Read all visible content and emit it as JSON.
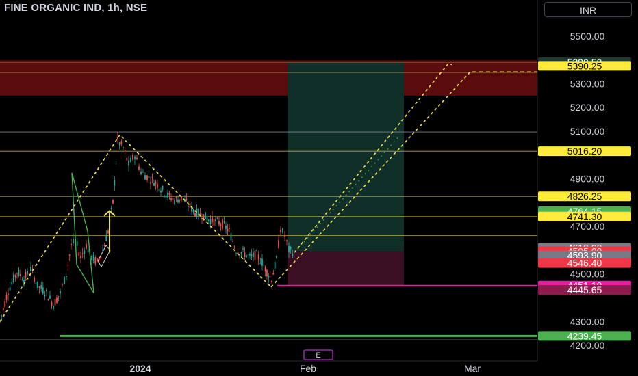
{
  "header": {
    "title": "FINE ORGANIC IND, 1h, NSE",
    "currency": "INR"
  },
  "chart_data": {
    "type": "candlestick",
    "title": "FINE ORGANIC IND, 1h, NSE",
    "ylim": [
      4160,
      5560
    ],
    "x_ticks": [
      "2024",
      "Feb",
      "Mar"
    ],
    "y_ticks": [
      "5500.00",
      "5300.00",
      "5200.00",
      "5100.00",
      "4900.00",
      "4700.00",
      "4500.00",
      "4300.00",
      "4200.00"
    ],
    "price_tags": [
      {
        "label": "5390.50",
        "value": 5390.5,
        "bg": "#1e3a30",
        "fg": "#ffffff"
      },
      {
        "label": "5390.25",
        "value": 5375,
        "bg": "#ffeb3b",
        "fg": "#000000"
      },
      {
        "label": "5016.20",
        "value": 5016.2,
        "bg": "#ffeb3b",
        "fg": "#000000"
      },
      {
        "label": "4826.25",
        "value": 4826.25,
        "bg": "#ffeb3b",
        "fg": "#000000"
      },
      {
        "label": "4764.15",
        "value": 4764.15,
        "bg": "#4caf50",
        "fg": "#ffffff"
      },
      {
        "label": "4741.30",
        "value": 4741.3,
        "bg": "#ffeb3b",
        "fg": "#000000"
      },
      {
        "label": "4610.00",
        "value": 4610,
        "bg": "#787b86",
        "fg": "#ffffff"
      },
      {
        "label": "4595.00",
        "value": 4595,
        "bg": "#f23645",
        "fg": "#ffffff"
      },
      {
        "label": "4593.90",
        "value": 4578,
        "bg": "#787b86",
        "fg": "#ffffff"
      },
      {
        "label": "4546.40",
        "value": 4546.4,
        "bg": "#f23645",
        "fg": "#ffffff"
      },
      {
        "label": "4451.10",
        "value": 4451.1,
        "bg": "#e91e9f",
        "fg": "#ffffff"
      },
      {
        "label": "4445.65",
        "value": 4433,
        "bg": "#8c1c4e",
        "fg": "#ffffff"
      },
      {
        "label": "4239.45",
        "value": 4239.45,
        "bg": "#4caf50",
        "fg": "#ffffff"
      }
    ],
    "horizontal_levels": [
      {
        "value": 5390.5,
        "color": "#c8a86a"
      },
      {
        "value": 5347,
        "color": "#c8a86a"
      },
      {
        "value": 5097,
        "color": "#9aa0aa"
      },
      {
        "value": 5016.2,
        "color": "#e6c84a"
      },
      {
        "value": 4826.25,
        "color": "#e6c84a"
      },
      {
        "value": 4741.3,
        "color": "#e6c84a"
      },
      {
        "value": 4662,
        "color": "#e6c84a"
      },
      {
        "value": 4223,
        "color": "#9aa0aa"
      }
    ],
    "resistance_zone": [
      5250,
      5398
    ],
    "support_line": 4239.45,
    "entry_line": 4451.1,
    "position": {
      "profit_top": 5390.5,
      "entry": 4595,
      "stop": 4451.1
    },
    "price_path": [
      [
        0,
        4300
      ],
      [
        12,
        4430
      ],
      [
        25,
        4510
      ],
      [
        35,
        4480
      ],
      [
        45,
        4520
      ],
      [
        55,
        4450
      ],
      [
        68,
        4420
      ],
      [
        78,
        4370
      ],
      [
        88,
        4420
      ],
      [
        97,
        4500
      ],
      [
        104,
        4620
      ],
      [
        110,
        4640
      ],
      [
        118,
        4570
      ],
      [
        126,
        4620
      ],
      [
        134,
        4570
      ],
      [
        142,
        4550
      ],
      [
        150,
        4600
      ],
      [
        158,
        4680
      ],
      [
        165,
        4800
      ],
      [
        172,
        5060
      ],
      [
        180,
        5030
      ],
      [
        188,
        4960
      ],
      [
        197,
        5000
      ],
      [
        206,
        4930
      ],
      [
        215,
        4910
      ],
      [
        225,
        4890
      ],
      [
        235,
        4860
      ],
      [
        245,
        4830
      ],
      [
        255,
        4810
      ],
      [
        265,
        4820
      ],
      [
        275,
        4790
      ],
      [
        285,
        4760
      ],
      [
        295,
        4750
      ],
      [
        305,
        4730
      ],
      [
        315,
        4720
      ],
      [
        325,
        4710
      ],
      [
        335,
        4680
      ],
      [
        345,
        4600
      ],
      [
        355,
        4590
      ],
      [
        365,
        4570
      ],
      [
        375,
        4580
      ],
      [
        383,
        4550
      ],
      [
        390,
        4510
      ],
      [
        397,
        4480
      ],
      [
        404,
        4560
      ],
      [
        410,
        4690
      ],
      [
        416,
        4660
      ],
      [
        422,
        4600
      ],
      [
        430,
        4590
      ]
    ],
    "patterns": {
      "yellow_wave": [
        [
          0,
          4300
        ],
        [
          175,
          5085
        ],
        [
          396,
          4445
        ]
      ],
      "yellow_projection_1": [
        [
          396,
          4445
        ],
        [
          687,
          5350
        ]
      ],
      "yellow_projection_2": [
        [
          430,
          4590
        ],
        [
          655,
          5385
        ],
        [
          660,
          5380
        ]
      ],
      "dotted_green": [
        [
          430,
          4590
        ],
        [
          585,
          5085
        ]
      ],
      "green_shape": [
        [
          105,
          4925
        ],
        [
          128,
          4680
        ],
        [
          137,
          4420
        ],
        [
          112,
          4540
        ],
        [
          105,
          4925
        ]
      ],
      "white_diamond": [
        [
          143,
          4555
        ],
        [
          155,
          4620
        ],
        [
          161,
          4600
        ],
        [
          148,
          4530
        ],
        [
          143,
          4555
        ]
      ],
      "yellow_arrow": [
        [
          160,
          4590
        ],
        [
          160,
          4760
        ]
      ]
    }
  },
  "footer": {
    "event_badge": "E"
  }
}
